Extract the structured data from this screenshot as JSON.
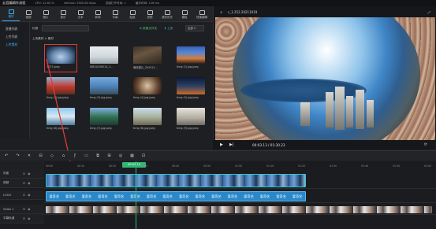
{
  "topbar": {
    "title": "云音编辑作流程",
    "cpu": "CPU: 12.63 %",
    "net": "netCost: 2500.64 kbps",
    "recv": "流媒打开时间: 1",
    "status": "缓冲时间: 126 ms"
  },
  "toolbar": {
    "items": [
      {
        "label": "素材",
        "icon": "folder-icon",
        "active": true
      },
      {
        "label": "视频",
        "icon": "video-icon"
      },
      {
        "label": "图片",
        "icon": "image-icon"
      },
      {
        "label": "音乐",
        "icon": "music-icon"
      },
      {
        "label": "文本",
        "icon": "text-icon"
      },
      {
        "label": "转场",
        "icon": "transition-icon"
      },
      {
        "label": "字幕",
        "icon": "subtitle-icon"
      },
      {
        "label": "贴纸",
        "icon": "sticker-icon"
      },
      {
        "label": "滤镜",
        "icon": "filter-icon"
      },
      {
        "label": "我的历史",
        "icon": "history-icon"
      },
      {
        "label": "模板",
        "icon": "template-icon"
      },
      {
        "label": "快速编辑",
        "icon": "quick-edit-icon"
      }
    ]
  },
  "sidebar": {
    "items": [
      {
        "label": "直播列表"
      },
      {
        "label": "上传列表"
      },
      {
        "label": "上传素材",
        "active": true
      }
    ]
  },
  "media": {
    "search_label": "标题",
    "search_placeholder": "",
    "new_folder_label": "⊕ 新建文件夹",
    "upload_label": "⬆ 上传",
    "sort_value": "全部",
    "breadcrumb": "上传素材 > 素材",
    "thumbs": [
      {
        "caption": "1237.jpeg",
        "style": "im-city",
        "selected": true
      },
      {
        "caption": "WB20190514_2...",
        "style": "im-white"
      },
      {
        "caption": "微信图片_201912...",
        "style": "im-dark"
      },
      {
        "caption": "timg (1).jpg.jpeg",
        "style": "im-sunset"
      },
      {
        "caption": "timg (2).jpg.jpeg",
        "style": "im-gate"
      },
      {
        "caption": "timg (3).jpg.jpeg",
        "style": "im-tower"
      },
      {
        "caption": "timg (4).jpg.jpeg",
        "style": "im-food"
      },
      {
        "caption": "timg (5).jpg.jpeg",
        "style": "im-night"
      },
      {
        "caption": "timg (6).jpg.jpeg",
        "style": "im-bridge"
      },
      {
        "caption": "timg (7).jpg.jpeg",
        "style": "im-lake"
      },
      {
        "caption": "timg (8).jpg.jpeg",
        "style": "im-pagoda"
      },
      {
        "caption": "timg (9).jpg.jpeg",
        "style": "im-building"
      }
    ]
  },
  "preview": {
    "title": "c_1.252.20211019",
    "close": "×",
    "expand": "⤢",
    "play": "▶",
    "next": "▶|",
    "timecode": "00:03.13 / 01:30.23",
    "loop": "⟳"
  },
  "timeline": {
    "tools": [
      "↶",
      "↷",
      "✕",
      "⊟",
      "◇",
      "⌂",
      "ƒ",
      "▭",
      "⧉",
      "⊞",
      "◎",
      "▦",
      "⊡"
    ],
    "ruler": [
      "00:00",
      "00:10",
      "00:20",
      "00:30",
      "00:40",
      "00:50",
      "01:00",
      "01:10",
      "01:20",
      "01:30",
      "01:40",
      "01:50",
      "02:00"
    ],
    "playhead_time": "00:03.13",
    "tracks": [
      {
        "name": "封面"
      },
      {
        "name": "视频"
      },
      {
        "name": "LOGO"
      },
      {
        "name": "Video 1"
      },
      {
        "name": "字幕轨道"
      }
    ],
    "logo_text": "爱奇艺"
  },
  "colors": {
    "accent": "#3ab7ff",
    "selection": "#e03a3a",
    "playhead": "#2fb574"
  }
}
